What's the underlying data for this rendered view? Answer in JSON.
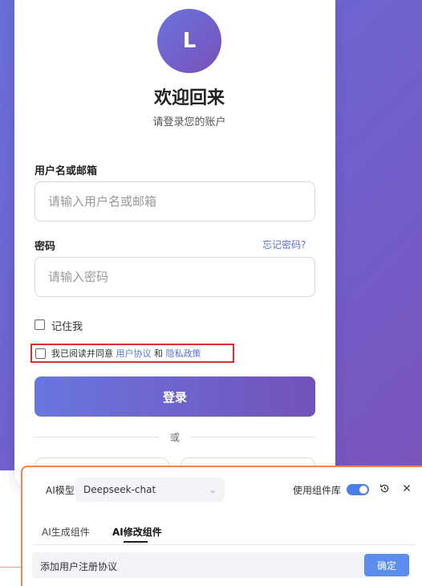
{
  "login": {
    "avatar_letter": "L",
    "title": "欢迎回来",
    "subtitle": "请登录您的账户",
    "username_label": "用户名或邮箱",
    "username_placeholder": "请输入用户名或邮箱",
    "password_label": "密码",
    "forgot_link": "忘记密码?",
    "password_placeholder": "请输入密码",
    "remember_label": "记住我",
    "agree_prefix": "我已阅读并同意",
    "user_agreement": "用户协议",
    "agree_and": "和",
    "privacy_policy": "隐私政策",
    "login_button": "登录",
    "divider_text": "或"
  },
  "ai_panel": {
    "model_label": "AI模型",
    "model_value": "Deepseek-chat",
    "component_lib_label": "使用组件库",
    "component_lib_enabled": true,
    "tabs": [
      {
        "label": "AI生成组件",
        "active": false
      },
      {
        "label": "AI修改组件",
        "active": true
      }
    ],
    "prompt_text": "添加用户注册协议",
    "confirm_button": "确定"
  },
  "colors": {
    "accent_blue": "#5a6fd6",
    "gradient_start": "#6a76e0",
    "gradient_end": "#7352b8",
    "highlight_red": "#d9302c",
    "panel_border": "#e8875a"
  }
}
